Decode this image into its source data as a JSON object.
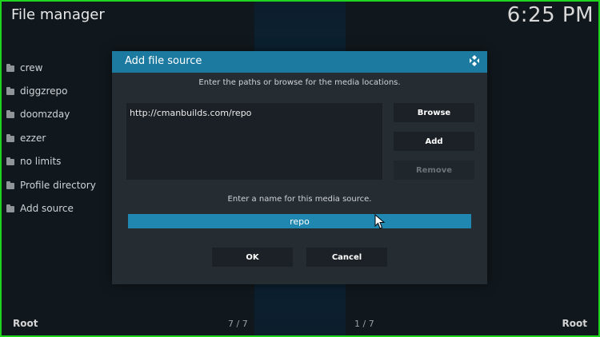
{
  "header": {
    "title": "File manager",
    "clock": "6:25 PM"
  },
  "sidebar": {
    "items": [
      {
        "label": "crew",
        "icon": "folder-icon"
      },
      {
        "label": "diggzrepo",
        "icon": "folder-icon"
      },
      {
        "label": "doomzday",
        "icon": "folder-icon"
      },
      {
        "label": "ezzer",
        "icon": "folder-icon"
      },
      {
        "label": "no limits",
        "icon": "folder-icon"
      },
      {
        "label": "Profile directory",
        "icon": "folder-icon"
      },
      {
        "label": "Add source",
        "icon": "folder-icon"
      }
    ]
  },
  "footer": {
    "left": "Root",
    "right": "Root",
    "count_left": "7 / 7",
    "count_right": "1 / 7"
  },
  "dialog": {
    "title": "Add file source",
    "instruction_paths": "Enter the paths or browse for the media locations.",
    "paths": [
      "http://cmanbuilds.com/repo"
    ],
    "browse_label": "Browse",
    "add_label": "Add",
    "remove_label": "Remove",
    "instruction_name": "Enter a name for this media source.",
    "name_value": "repo",
    "ok_label": "OK",
    "cancel_label": "Cancel"
  },
  "colors": {
    "accent": "#1f87b0",
    "header_bar": "#1c7aa0",
    "frame": "#1fd41f"
  }
}
